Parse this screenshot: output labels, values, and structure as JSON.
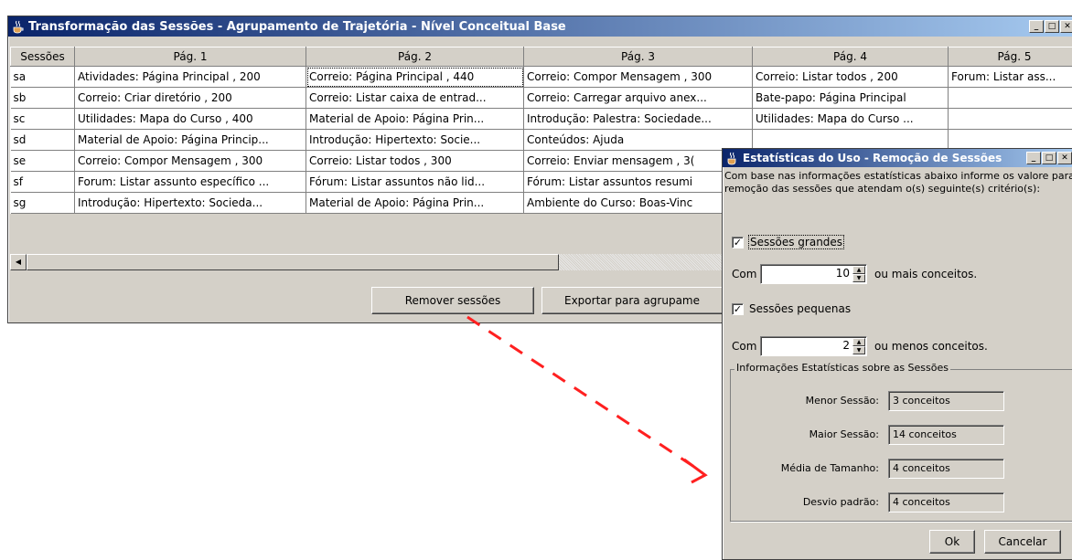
{
  "main_window": {
    "title": "Transformação das Sessões - Agrupamento de Trajetória - Nível Conceitual Base",
    "columns": [
      "Sessões",
      "Pág. 1",
      "Pág. 2",
      "Pág. 3",
      "Pág. 4",
      "Pág. 5"
    ],
    "rows": [
      [
        "sa",
        "Atividades: Página Principal , 200",
        "Correio: Página Principal , 440",
        "Correio: Compor Mensagem , 300",
        "Correio: Listar todos , 200",
        "Forum: Listar ass..."
      ],
      [
        "sb",
        "Correio: Criar diretório , 200",
        "Correio: Listar caixa de entrad...",
        "Correio: Carregar arquivo anex...",
        "Bate-papo: Página Principal",
        ""
      ],
      [
        "sc",
        "Utilidades: Mapa do Curso , 400",
        "Material de Apoio: Página Prin...",
        "Introdução: Palestra: Sociedade...",
        "Utilidades: Mapa do Curso ...",
        ""
      ],
      [
        "sd",
        "Material de Apoio: Página Princip...",
        "Introdução: Hipertexto: Socie...",
        "Conteúdos: Ajuda",
        "",
        ""
      ],
      [
        "se",
        "Correio: Compor Mensagem , 300",
        "Correio: Listar todos , 300",
        "Correio: Enviar mensagem , 3(",
        "",
        ""
      ],
      [
        "sf",
        "Forum: Listar assunto específico ...",
        "Fórum: Listar assuntos não lid...",
        "Fórum: Listar assuntos resumi",
        "",
        ""
      ],
      [
        "sg",
        "Introdução: Hipertexto: Socieda...",
        "Material de Apoio: Página Prin...",
        "Ambiente do Curso: Boas-Vinc",
        "",
        ""
      ]
    ],
    "remove_button": "Remover sessões",
    "export_button": "Exportar para agrupame"
  },
  "dialog": {
    "title": "Estatísticas do Uso - Remoção de Sessões",
    "description": "Com base nas informações estatísticas abaixo informe os valore para remoção das sessões que atendam o(s) seguinte(s) critério(s):",
    "large_sessions_label": "Sessões grandes",
    "large_checked": true,
    "com_label": "Com",
    "large_value": "10",
    "large_suffix": "ou mais conceitos.",
    "small_sessions_label": "Sessões pequenas",
    "small_checked": true,
    "small_value": "2",
    "small_suffix": "ou menos conceitos.",
    "stats_group_title": "Informações Estatísticas sobre as Sessões",
    "stats": [
      {
        "label": "Menor Sessão:",
        "value": "3 conceitos"
      },
      {
        "label": "Maior Sessão:",
        "value": "14 conceitos"
      },
      {
        "label": "Média de Tamanho:",
        "value": "4 conceitos"
      },
      {
        "label": "Desvio padrão:",
        "value": "4 conceitos"
      }
    ],
    "ok_button": "Ok",
    "cancel_button": "Cancelar"
  },
  "colors": {
    "arrow": "#ff2020",
    "title_gradient_start": "#0a246a"
  }
}
